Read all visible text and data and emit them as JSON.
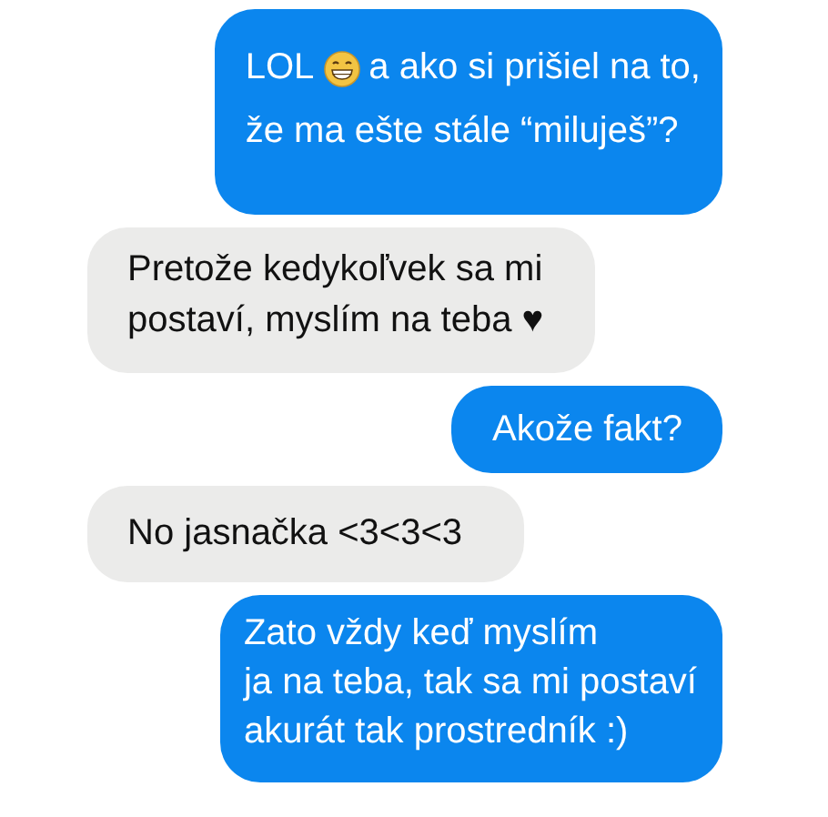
{
  "messages": [
    {
      "outgoing": true,
      "lines": [
        [
          {
            "kind": "text",
            "text": "LOL"
          },
          {
            "kind": "emoji"
          },
          {
            "kind": "text",
            "text": "a ako si prišiel na to,"
          }
        ],
        [
          {
            "kind": "text",
            "text": "že ma ešte stále “miluješ”?"
          }
        ]
      ]
    },
    {
      "outgoing": false,
      "lines": [
        [
          {
            "kind": "text",
            "text": "Pretože kedykoľvek sa mi"
          }
        ],
        [
          {
            "kind": "text",
            "text": "postaví, myslím na teba ♥"
          }
        ]
      ]
    },
    {
      "outgoing": true,
      "lines": [
        [
          {
            "kind": "text",
            "text": "Akože fakt?"
          }
        ]
      ]
    },
    {
      "outgoing": false,
      "lines": [
        [
          {
            "kind": "text",
            "text": "No jasnačka <3<3<3"
          }
        ]
      ]
    },
    {
      "outgoing": true,
      "lines": [
        [
          {
            "kind": "text",
            "text": "Zato vždy keď myslím"
          }
        ],
        [
          {
            "kind": "text",
            "text": "ja na teba, tak sa mi postaví"
          }
        ],
        [
          {
            "kind": "text",
            "text": "akurát tak prostredník :)"
          }
        ]
      ]
    }
  ]
}
